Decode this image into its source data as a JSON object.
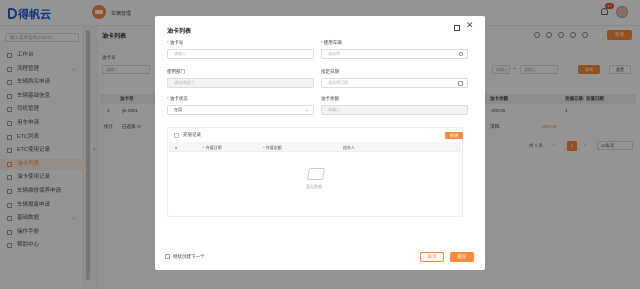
{
  "app": {
    "logo_text": "得帆云",
    "current_app": "车辆管理",
    "notification_count": "42"
  },
  "sidebar": {
    "search_placeholder": "输入菜单名称(Ctrl+K)",
    "items": [
      {
        "label": "工作台",
        "active": false,
        "has_children": false
      },
      {
        "label": "流程管理",
        "active": false,
        "has_children": true
      },
      {
        "label": "车辆购买申请",
        "active": false,
        "has_children": false
      },
      {
        "label": "车辆基础信息",
        "active": false,
        "has_children": false
      },
      {
        "label": "司机管理",
        "active": false,
        "has_children": false
      },
      {
        "label": "用车申请",
        "active": false,
        "has_children": false
      },
      {
        "label": "ETC列表",
        "active": false,
        "has_children": false
      },
      {
        "label": "ETC使用记录",
        "active": false,
        "has_children": false
      },
      {
        "label": "油卡列表",
        "active": true,
        "has_children": false
      },
      {
        "label": "油卡使用记录",
        "active": false,
        "has_children": false
      },
      {
        "label": "车辆维修保养申请",
        "active": false,
        "has_children": false
      },
      {
        "label": "车辆报废申请",
        "active": false,
        "has_children": false
      },
      {
        "label": "基础数据",
        "active": false,
        "has_children": true
      },
      {
        "label": "操作手册",
        "active": false,
        "has_children": false
      },
      {
        "label": "帮助中心",
        "active": false,
        "has_children": false
      }
    ]
  },
  "background": {
    "title": "油卡列表",
    "add_label": "新增",
    "filter_label": "油卡号",
    "filter_placeholder": "请输入",
    "range_placeholder_1": "请输入",
    "range_separator": "~",
    "range_placeholder_2": "请输入",
    "search_label": "查询",
    "reset_label": "重置",
    "columns": [
      "油卡号",
      "油卡余额",
      "充值记录: 充值日期"
    ],
    "row": {
      "index": "1",
      "card": "yk-0001",
      "balance": "-200.00",
      "count": "1"
    },
    "summary": {
      "label": "统计",
      "selected": "已选择: 0",
      "balance_label": "求和:",
      "balance_value": "-200.00"
    },
    "pager": {
      "total": "共 1 条",
      "page": "1",
      "page_size": "10条/页"
    }
  },
  "modal": {
    "title": "油卡列表",
    "fields": {
      "card_no": {
        "label": "油卡号",
        "required": true,
        "placeholder": "请输入"
      },
      "vehicle": {
        "label": "使用车辆",
        "required": true,
        "placeholder": "请选择"
      },
      "department": {
        "label": "使用部门",
        "required": false,
        "placeholder": "请选择部门"
      },
      "date": {
        "label": "指定日期",
        "required": false,
        "placeholder": "请选择日期"
      },
      "status": {
        "label": "油卡状态",
        "required": true,
        "value": "在用"
      },
      "balance": {
        "label": "油卡余额",
        "required": false,
        "placeholder": "请输入"
      }
    },
    "recharge": {
      "title": "充值记录",
      "add_label": "新增",
      "columns": [
        "#",
        "充值日期",
        "充值金额",
        "经办人"
      ],
      "empty_text": "暂无数据"
    },
    "continue_label": "继续创建下一个",
    "cancel_label": "取消",
    "submit_label": "提交"
  }
}
